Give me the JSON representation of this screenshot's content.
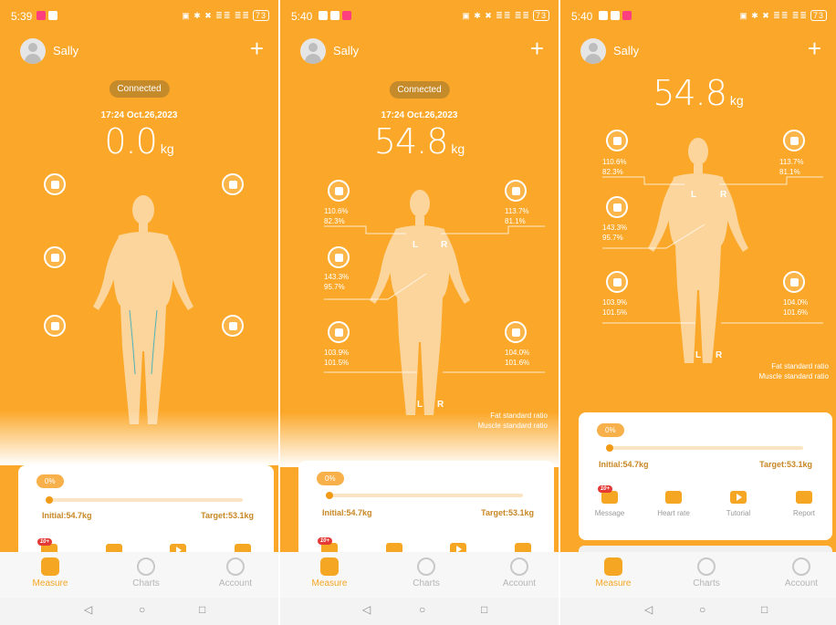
{
  "status": {
    "time1": "5:39",
    "time2": "5:40",
    "time3": "5:40",
    "right": "▣ ✱ ✖ ≣≣ ≣≣",
    "battery": "73"
  },
  "user": {
    "name": "Sally"
  },
  "header": {
    "plus": "+"
  },
  "scale": {
    "connected": "Connected",
    "datetime": "17:24 Oct.26,2023",
    "weight_zero": "0.0",
    "weight": "54.8",
    "unit": "kg"
  },
  "segments": {
    "left_arm": [
      "110.6%",
      "82.3%"
    ],
    "right_arm": [
      "113.7%",
      "81.1%"
    ],
    "trunk": [
      "143.3%",
      "95.7%"
    ],
    "left_leg": [
      "103.9%",
      "101.5%"
    ],
    "right_leg": [
      "104.0%",
      "101.6%"
    ]
  },
  "markers": {
    "left": "L",
    "right": "R"
  },
  "legend": {
    "fat": "Fat standard ratio",
    "muscle": "Muscle standard ratio"
  },
  "goal": {
    "progress_label": "0%",
    "progress": 0,
    "initial": "Initial:54.7kg",
    "target": "Target:53.1kg"
  },
  "actions": [
    {
      "label": "Message",
      "icon": "message-icon",
      "badge": "10+"
    },
    {
      "label": "Heart rate",
      "icon": "heart-rate-icon"
    },
    {
      "label": "Tutorial",
      "icon": "tutorial-icon"
    },
    {
      "label": "Report",
      "icon": "report-icon"
    }
  ],
  "tabs": [
    {
      "label": "Measure",
      "icon": "scale-icon",
      "active": true
    },
    {
      "label": "Charts",
      "icon": "charts-icon"
    },
    {
      "label": "Account",
      "icon": "account-icon"
    }
  ],
  "navbar": {
    "back": "◁",
    "home": "○",
    "recent": "□"
  },
  "colors": {
    "primary": "#fba82a",
    "accent": "#f5a623",
    "badge": "#e53935"
  }
}
